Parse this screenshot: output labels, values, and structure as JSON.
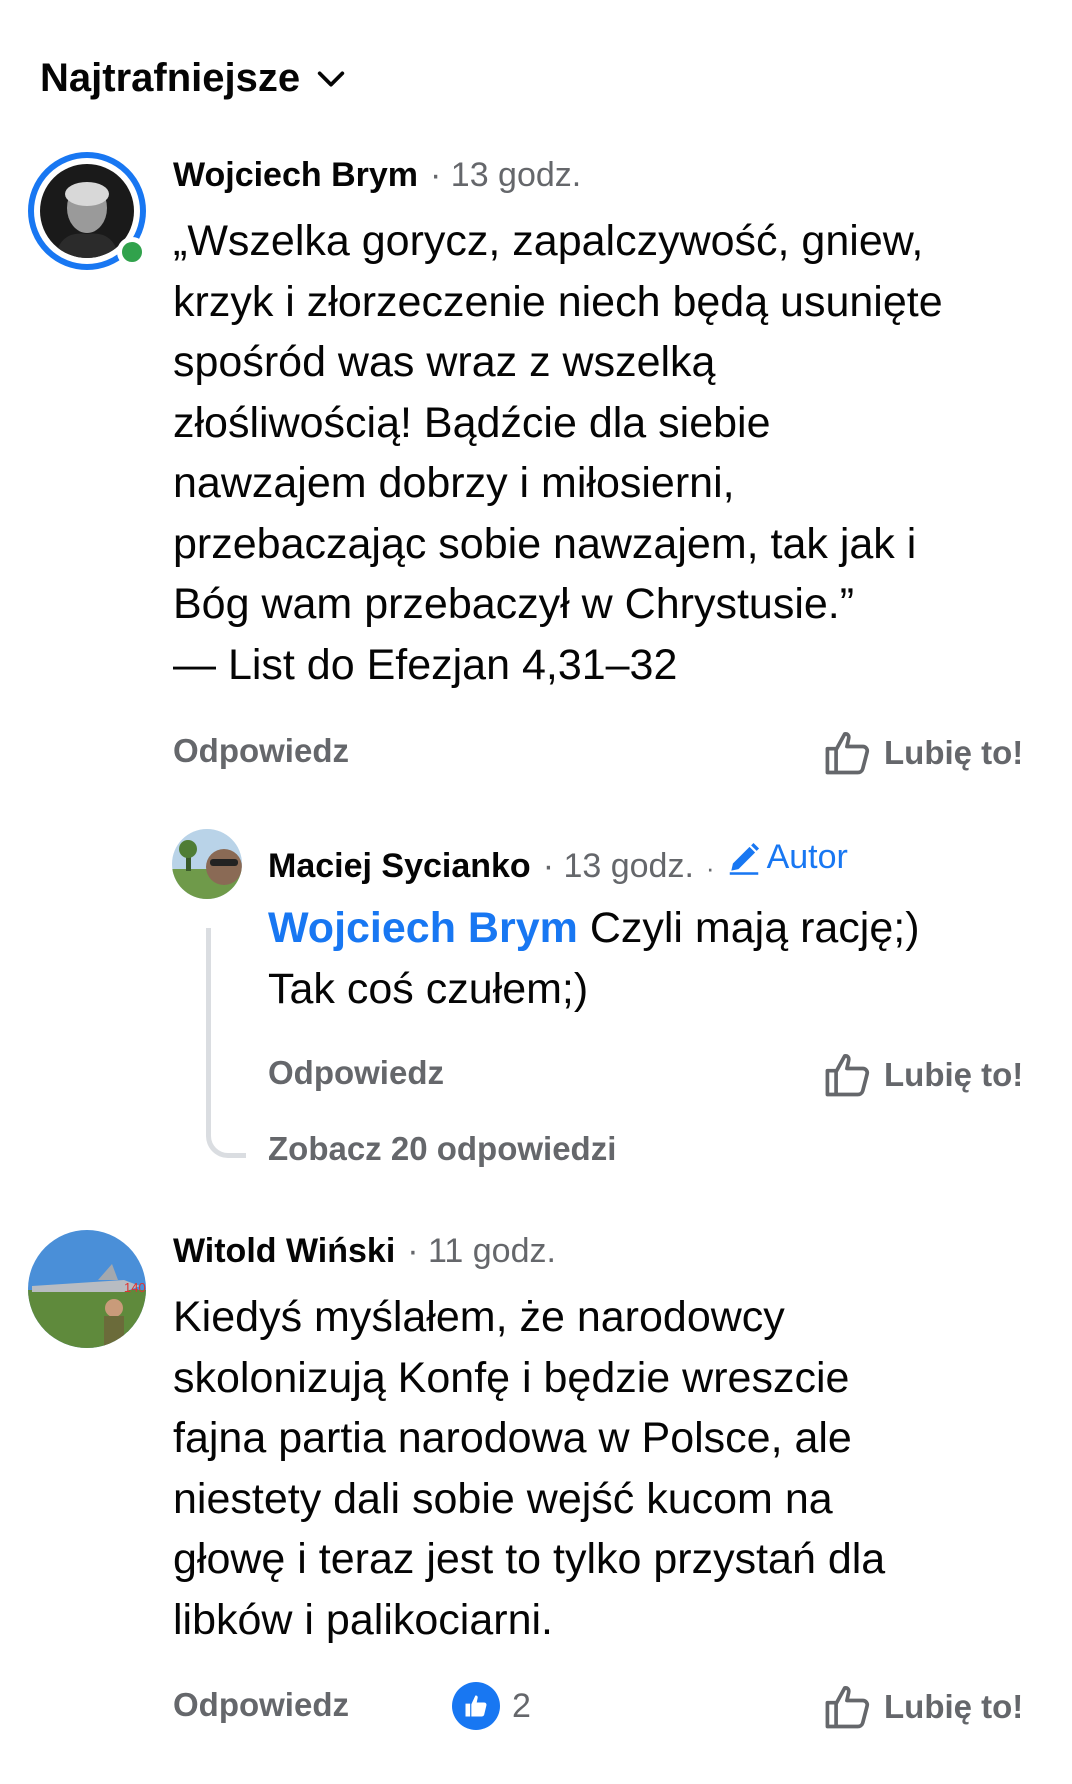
{
  "sort": {
    "label": "Najtrafniejsze"
  },
  "comments": [
    {
      "author": "Wojciech Brym",
      "time": "· 13 godz.",
      "text": "„Wszelka gorycz, zapalczywość, gniew,\nkrzyk i złorzeczenie niech będą usunięte\nspośród was wraz z wszelką\nzłośliwością! Bądźcie dla siebie\nnawzajem dobrzy i miłosierni,\nprzebaczając sobie nawzajem, tak jak i\nBóg wam przebaczył w Chrystusie.”\n— List do Efezjan 4,31–32",
      "reply_label": "Odpowiedz",
      "like_label": "Lubię to!"
    },
    {
      "author": "Maciej Sycianko",
      "time": "· 13 godz.",
      "separator": "·",
      "badge": "Autor",
      "mention": "Wojciech Brym",
      "text_line1": " Czyli mają rację;)",
      "text_line2": "Tak coś czułem;)",
      "reply_label": "Odpowiedz",
      "like_label": "Lubię to!",
      "see_replies": "Zobacz 20 odpowiedzi"
    },
    {
      "author": "Witold Wiński",
      "time": "· 11 godz.",
      "text": "Kiedyś myślałem, że narodowcy\nskolonizują Konfę i będzie wreszcie\nfajna partia narodowa w Polsce, ale\nniestety dali sobie wejść kucom na\ngłowę i teraz jest to tylko przystań dla\nlibków i palikociarni.",
      "reply_label": "Odpowiedz",
      "reaction_count": "2",
      "like_label": "Lubię to!"
    }
  ],
  "colors": {
    "accent": "#1877f2",
    "online": "#31a24c",
    "muted": "#65676b"
  },
  "icons": [
    "chevron-down-icon",
    "thumbs-up-icon",
    "pencil-icon",
    "like-reaction-icon"
  ]
}
